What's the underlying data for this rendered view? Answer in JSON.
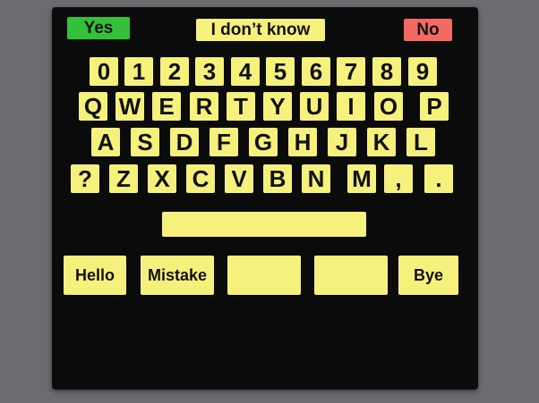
{
  "top_buttons": {
    "yes": "Yes",
    "unknown": "I don’t know",
    "no": "No"
  },
  "keyboard": {
    "row_digits": [
      "0",
      "1",
      "2",
      "3",
      "4",
      "5",
      "6",
      "7",
      "8",
      "9"
    ],
    "row_q": [
      "Q",
      "W",
      "E",
      "R",
      "T",
      "Y",
      "U",
      "I",
      "O",
      "P"
    ],
    "row_a": [
      "A",
      "S",
      "D",
      "F",
      "G",
      "H",
      "J",
      "K",
      "L"
    ],
    "row_z": [
      "?",
      "Z",
      "X",
      "C",
      "V",
      "B",
      "N",
      "M",
      ",",
      "."
    ]
  },
  "phrases": {
    "hello": "Hello",
    "mistake": "Mistake",
    "blank_1": "",
    "blank_2": "",
    "bye": "Bye"
  },
  "colors": {
    "board": "#0b0b0b",
    "key": "#f6f07c",
    "yes": "#35c03a",
    "no": "#f26a62",
    "background": "#6b6b70"
  }
}
